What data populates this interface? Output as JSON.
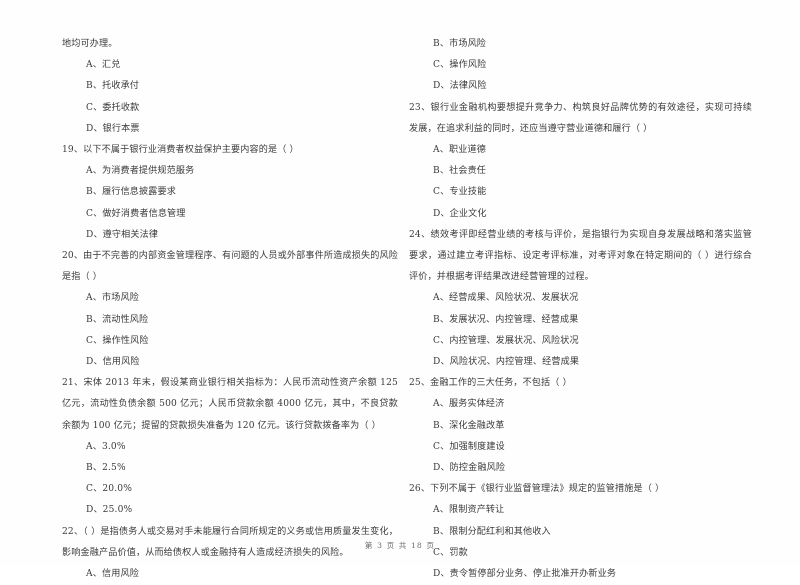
{
  "document": {
    "footer": "第 3 页 共 18 页",
    "page_number": "3",
    "total_pages": "18"
  },
  "left_column": {
    "blocks": [
      {
        "kind": "continuation",
        "text": "地均可办理。"
      },
      {
        "kind": "option",
        "text": "A、汇兑"
      },
      {
        "kind": "option",
        "text": "B、托收承付"
      },
      {
        "kind": "option",
        "text": "C、委托收款"
      },
      {
        "kind": "option",
        "text": "D、银行本票"
      },
      {
        "kind": "stem",
        "text": "19、以下不属于银行业消费者权益保护主要内容的是（      ）"
      },
      {
        "kind": "option",
        "text": "A、为消费者提供规范服务"
      },
      {
        "kind": "option",
        "text": "B、履行信息披露要求"
      },
      {
        "kind": "option",
        "text": "C、做好消费者信息管理"
      },
      {
        "kind": "option",
        "text": "D、遵守相关法律"
      },
      {
        "kind": "stem",
        "text": "20、由于不完善的内部资金管理程序、有问题的人员或外部事件所造成损失的风险是指（      ）"
      },
      {
        "kind": "option",
        "text": "A、市场风险"
      },
      {
        "kind": "option",
        "text": "B、流动性风险"
      },
      {
        "kind": "option",
        "text": "C、操作性风险"
      },
      {
        "kind": "option",
        "text": "D、信用风险"
      },
      {
        "kind": "stem",
        "text": "21、宋体 2013 年末，假设某商业银行相关指标为：人民币流动性资产余额 125 亿元，流动性负债余额 500 亿元；人民币贷款余额 4000 亿元，其中，不良贷款余额为 100 亿元；提留的贷款损失准备为 120 亿元。该行贷款拨备率为（      ）"
      },
      {
        "kind": "option",
        "text": "A、3.0%"
      },
      {
        "kind": "option",
        "text": "B、2.5%"
      },
      {
        "kind": "option",
        "text": "C、20.0%"
      },
      {
        "kind": "option",
        "text": "D、25.0%"
      },
      {
        "kind": "stem",
        "text": "22、（      ）是指债务人或交易对手未能履行合同所规定的义务或信用质量发生变化，影响金融产品价值，从而给债权人或金融持有人造成经济损失的风险。"
      },
      {
        "kind": "option",
        "text": "A、信用风险"
      }
    ]
  },
  "right_column": {
    "blocks": [
      {
        "kind": "option",
        "text": "B、市场风险"
      },
      {
        "kind": "option",
        "text": "C、操作风险"
      },
      {
        "kind": "option",
        "text": "D、法律风险"
      },
      {
        "kind": "stem",
        "text": "23、银行业金融机构要想提升竞争力、构筑良好品牌优势的有效途径，实现可持续发展，在追求利益的同时，还应当遵守营业道德和履行（      ）"
      },
      {
        "kind": "option",
        "text": "A、职业道德"
      },
      {
        "kind": "option",
        "text": "B、社会责任"
      },
      {
        "kind": "option",
        "text": "C、专业技能"
      },
      {
        "kind": "option",
        "text": "D、企业文化"
      },
      {
        "kind": "stem",
        "text": "24、绩效考评即经营业绩的考核与评价，是指银行为实现自身发展战略和落实监管要求，通过建立考评指标、设定考评标准，对考评对象在特定期间的（      ）进行综合评价，并根据考评结果改进经营管理的过程。"
      },
      {
        "kind": "option",
        "text": "A、经营成果、风险状况、发展状况"
      },
      {
        "kind": "option",
        "text": "B、发展状况、内控管理、经营成果"
      },
      {
        "kind": "option",
        "text": "C、内控管理、发展状况、风险状况"
      },
      {
        "kind": "option",
        "text": "D、风险状况、内控管理、经营成果"
      },
      {
        "kind": "stem",
        "text": "25、金融工作的三大任务，不包括（      ）"
      },
      {
        "kind": "option",
        "text": "A、服务实体经济"
      },
      {
        "kind": "option",
        "text": "B、深化金融改革"
      },
      {
        "kind": "option",
        "text": "C、加强制度建设"
      },
      {
        "kind": "option",
        "text": "D、防控金融风险"
      },
      {
        "kind": "stem",
        "text": "26、下列不属于《银行业监督管理法》规定的监管措施是（      ）"
      },
      {
        "kind": "option",
        "text": "A、限制资产转让"
      },
      {
        "kind": "option",
        "text": "B、限制分配红利和其他收入"
      },
      {
        "kind": "option",
        "text": "C、罚款"
      },
      {
        "kind": "option",
        "text": "D、责令暂停部分业务、停止批准开办新业务"
      }
    ]
  }
}
